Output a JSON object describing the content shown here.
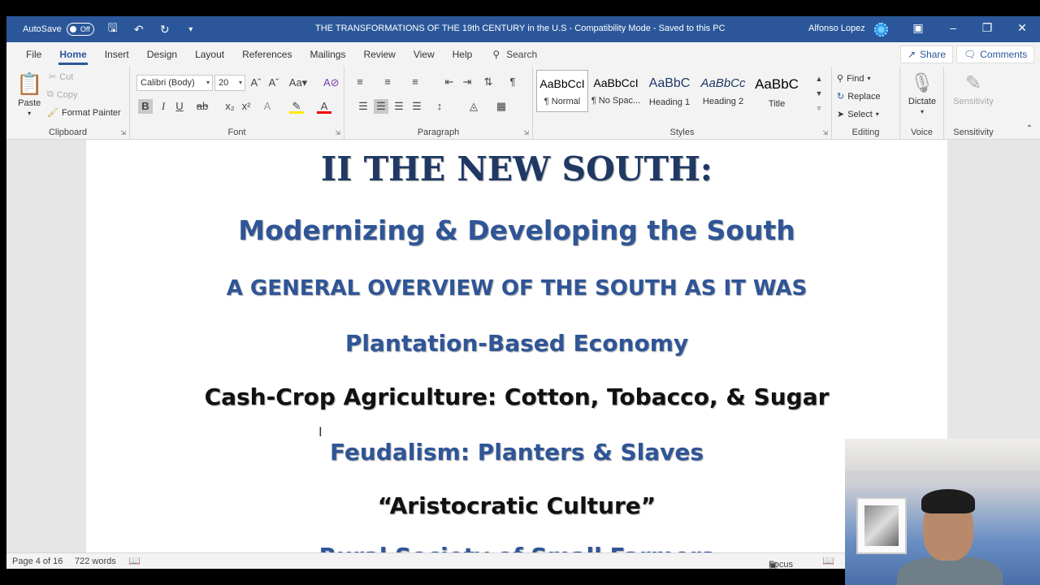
{
  "titlebar": {
    "autosave_label": "AutoSave",
    "autosave_state": "Off",
    "document_title": "THE TRANSFORMATIONS OF THE 19th CENTURY in the U.S  -  Compatibility Mode  -  Saved to this PC",
    "user_name": "Alfonso Lopez"
  },
  "menu": {
    "tabs": [
      "File",
      "Home",
      "Insert",
      "Design",
      "Layout",
      "References",
      "Mailings",
      "Review",
      "View",
      "Help"
    ],
    "active_tab": "Home",
    "search_label": "Search",
    "share_label": "Share",
    "comments_label": "Comments"
  },
  "ribbon": {
    "clipboard": {
      "paste_label": "Paste",
      "cut_label": "Cut",
      "copy_label": "Copy",
      "format_painter_label": "Format Painter",
      "group_label": "Clipboard"
    },
    "font": {
      "font_name": "Calibri (Body)",
      "font_size": "20",
      "group_label": "Font"
    },
    "paragraph": {
      "group_label": "Paragraph"
    },
    "styles": {
      "items": [
        {
          "preview": "AaBbCcI",
          "name": "¶ Normal"
        },
        {
          "preview": "AaBbCcI",
          "name": "¶ No Spac..."
        },
        {
          "preview": "AaBbC",
          "name": "Heading 1"
        },
        {
          "preview": "AaBbCc",
          "name": "Heading 2"
        },
        {
          "preview": "AaBbC",
          "name": "Title"
        }
      ],
      "group_label": "Styles"
    },
    "editing": {
      "find_label": "Find",
      "replace_label": "Replace",
      "select_label": "Select",
      "group_label": "Editing"
    },
    "voice": {
      "dictate_label": "Dictate",
      "group_label": "Voice"
    },
    "sensitivity": {
      "button_label": "Sensitivity",
      "group_label": "Sensitivity"
    }
  },
  "document": {
    "lines": [
      "II THE NEW SOUTH:",
      "Modernizing & Developing the South",
      "A GENERAL OVERVIEW OF THE SOUTH AS IT WAS",
      "Plantation-Based Economy",
      "Cash-Crop Agriculture: Cotton, Tobacco, & Sugar",
      "Feudalism: Planters & Slaves",
      "“Aristocratic Culture”",
      "Rural Society of Small Farmers"
    ]
  },
  "statusbar": {
    "page_info": "Page 4 of 16",
    "word_count": "722 words",
    "focus_label": "Focus"
  },
  "colors": {
    "title_bar": "#2b579a",
    "heading_dark": "#1f3864",
    "heading_blue": "#2f5597"
  }
}
